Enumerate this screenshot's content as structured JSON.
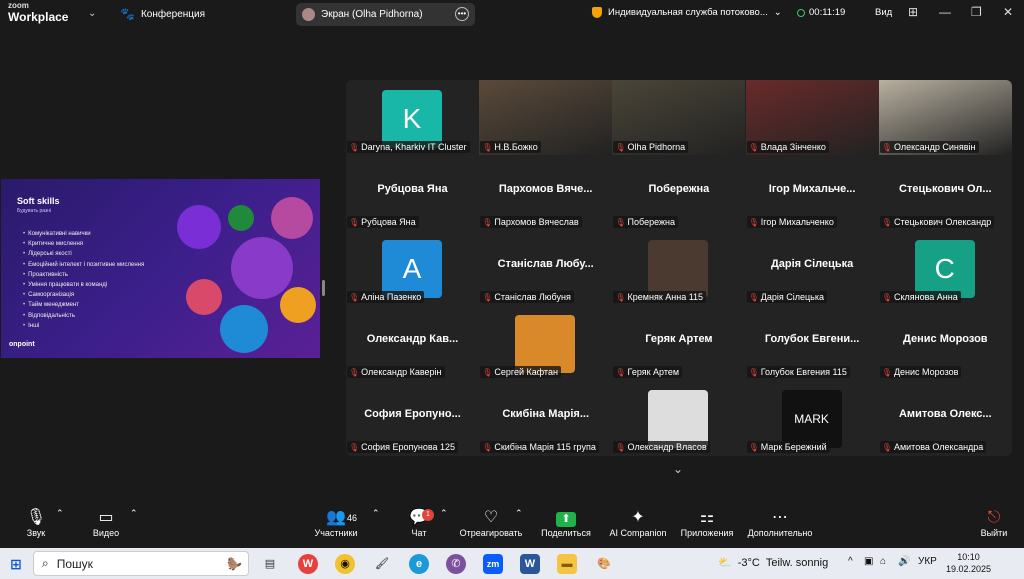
{
  "app": {
    "brand_top": "zoom",
    "brand_bottom": "Workplace",
    "conference": "Конференция"
  },
  "share_pill": {
    "label": "Экран (Olha Pidhorna)"
  },
  "service": "Индивидуальная служба потоково...",
  "timer": "00:11:19",
  "view": "Вид",
  "slide": {
    "title": "Soft skills",
    "subtitle": "Будувать разні",
    "items": [
      "Комунікативні навички",
      "Критичне мислення",
      "Лідерські якості",
      "Емоційний інтелект і позитивне мислення",
      "Проактивність",
      "Уміння працювати в команді",
      "Самоорганізація",
      "Тайм менеджмент",
      "Відповідальність",
      "Інші"
    ],
    "logo": "onpoint"
  },
  "participants": [
    {
      "name": "",
      "label": "Daryna, Kharkiv IT Cluster",
      "kind": "logo",
      "color": "#19b7a8",
      "letter": "K"
    },
    {
      "name": "",
      "label": "Н.В.Божко",
      "kind": "video",
      "color": "#5a4a3a"
    },
    {
      "name": "",
      "label": "Olha Pidhorna",
      "kind": "video",
      "color": "#4a4538",
      "active": true
    },
    {
      "name": "",
      "label": "Влада Зінченко",
      "kind": "video",
      "color": "#6a2a2a"
    },
    {
      "name": "",
      "label": "Олександр Синявін",
      "kind": "video",
      "color": "#b8b0a0"
    },
    {
      "name": "Рубцова Яна",
      "label": "Рубцова Яна",
      "kind": "name"
    },
    {
      "name": "Пархомов Вяче...",
      "label": "Пархомов Вячеслав",
      "kind": "name"
    },
    {
      "name": "Побережна",
      "label": "Побережна",
      "kind": "name"
    },
    {
      "name": "Ігор Михальче...",
      "label": "Ігор Михальченко",
      "kind": "name"
    },
    {
      "name": "Стецькович Ол...",
      "label": "Стецькович Олександр",
      "kind": "name"
    },
    {
      "name": "",
      "label": "Аліна Пазенко",
      "kind": "avatar",
      "color": "#1f8ad6",
      "letter": "A"
    },
    {
      "name": "Станіслав Любу...",
      "label": "Станіслав Любуня",
      "kind": "name"
    },
    {
      "name": "",
      "label": "Кремняк Анна 115",
      "kind": "avatar",
      "color": "#4a3a30",
      "letter": ""
    },
    {
      "name": "Дарія Сілецька",
      "label": "Дарія Сілецька",
      "kind": "name"
    },
    {
      "name": "",
      "label": "Склянова Анна",
      "kind": "avatar",
      "color": "#16a085",
      "letter": "C"
    },
    {
      "name": "Олександр Кав...",
      "label": "Олександр Каверін",
      "kind": "name"
    },
    {
      "name": "",
      "label": "Сергей Кафтан",
      "kind": "avatar",
      "color": "#d9892a",
      "letter": ""
    },
    {
      "name": "Геряк Артем",
      "label": "Геряк Артем",
      "kind": "name"
    },
    {
      "name": "Голубок Евгени...",
      "label": "Голубок Евгения 115",
      "kind": "name"
    },
    {
      "name": "Денис Морозов",
      "label": "Денис Морозов",
      "kind": "name"
    },
    {
      "name": "София Еропуно...",
      "label": "София Еропунова 125",
      "kind": "name"
    },
    {
      "name": "Скибіна Марія...",
      "label": "Скибіна Марія 115 група",
      "kind": "name"
    },
    {
      "name": "",
      "label": "Олександр Власов",
      "kind": "avatar",
      "color": "#ddd",
      "letter": ""
    },
    {
      "name": "",
      "label": "Марк Бережний",
      "kind": "avatar",
      "color": "#111",
      "letter": "MARK"
    },
    {
      "name": "Амитова Олекс...",
      "label": "Амитова Олександра",
      "kind": "name"
    }
  ],
  "toolbar": {
    "audio": "Звук",
    "video": "Видео",
    "participants": "Участники",
    "participants_count": "46",
    "chat": "Чат",
    "chat_badge": "1",
    "react": "Отреагировать",
    "share": "Поделиться",
    "ai": "AI Companion",
    "apps": "Приложения",
    "more": "Дополнительно",
    "leave": "Выйти"
  },
  "taskbar": {
    "search": "Пошук",
    "weather_temp": "-3°C",
    "weather_text": "Teilw. sonnig",
    "lang": "УКР",
    "time": "10:10",
    "date": "19.02.2025"
  }
}
